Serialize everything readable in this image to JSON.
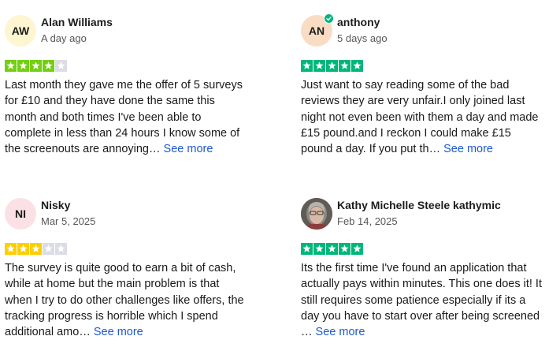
{
  "colors": {
    "star_green": "#00b67a",
    "star_light_green": "#73cf11",
    "star_yellow": "#ffce00",
    "star_empty": "#dcdce6",
    "link_blue": "#1c58d6",
    "verified_green": "#00b67a"
  },
  "reviews": [
    {
      "avatar_initials": "AW",
      "avatar_bg": "#fdf6d1",
      "name": "Alan Williams",
      "date": "A day ago",
      "rating": 4,
      "star_color": "#73cf11",
      "text": "Last month they gave me the offer of 5 surveys for £10 and they have done the same this month and both times I've been able to complete in less than 24 hours I know some of the screenouts are annoying…",
      "see_more": "See more"
    },
    {
      "avatar_initials": "AN",
      "avatar_bg": "#f9dcc3",
      "verified": true,
      "verified_icon": "verified-check-icon",
      "name": "anthony",
      "date": "5 days ago",
      "rating": 5,
      "star_color": "#00b67a",
      "text": "Just want to say reading some of the bad reviews they are very unfair.I only joined last night not even been with them a day and made £15 pound.and I reckon I could make £15 pound a day. If you put th…",
      "see_more": "See more"
    },
    {
      "avatar_initials": "NI",
      "avatar_bg": "#fbe1e6",
      "name": "Nisky",
      "date": "Mar 5, 2025",
      "rating": 3,
      "star_color": "#ffce00",
      "text": "The survey is quite good to earn a bit of cash, while at home but the main problem is that when I try to do other challenges like offers, the tracking progress is horrible which I spend additional amo…",
      "see_more": "See more"
    },
    {
      "avatar_photo": "user-photo-icon",
      "name": "Kathy Michelle Steele kathymic",
      "date": "Feb 14, 2025",
      "rating": 5,
      "star_color": "#00b67a",
      "text": "Its the first time I've found an application that actually pays within minutes. This one does it! It still requires some patience especially if its a day you have to start over after being screened …",
      "see_more": "See more"
    }
  ]
}
